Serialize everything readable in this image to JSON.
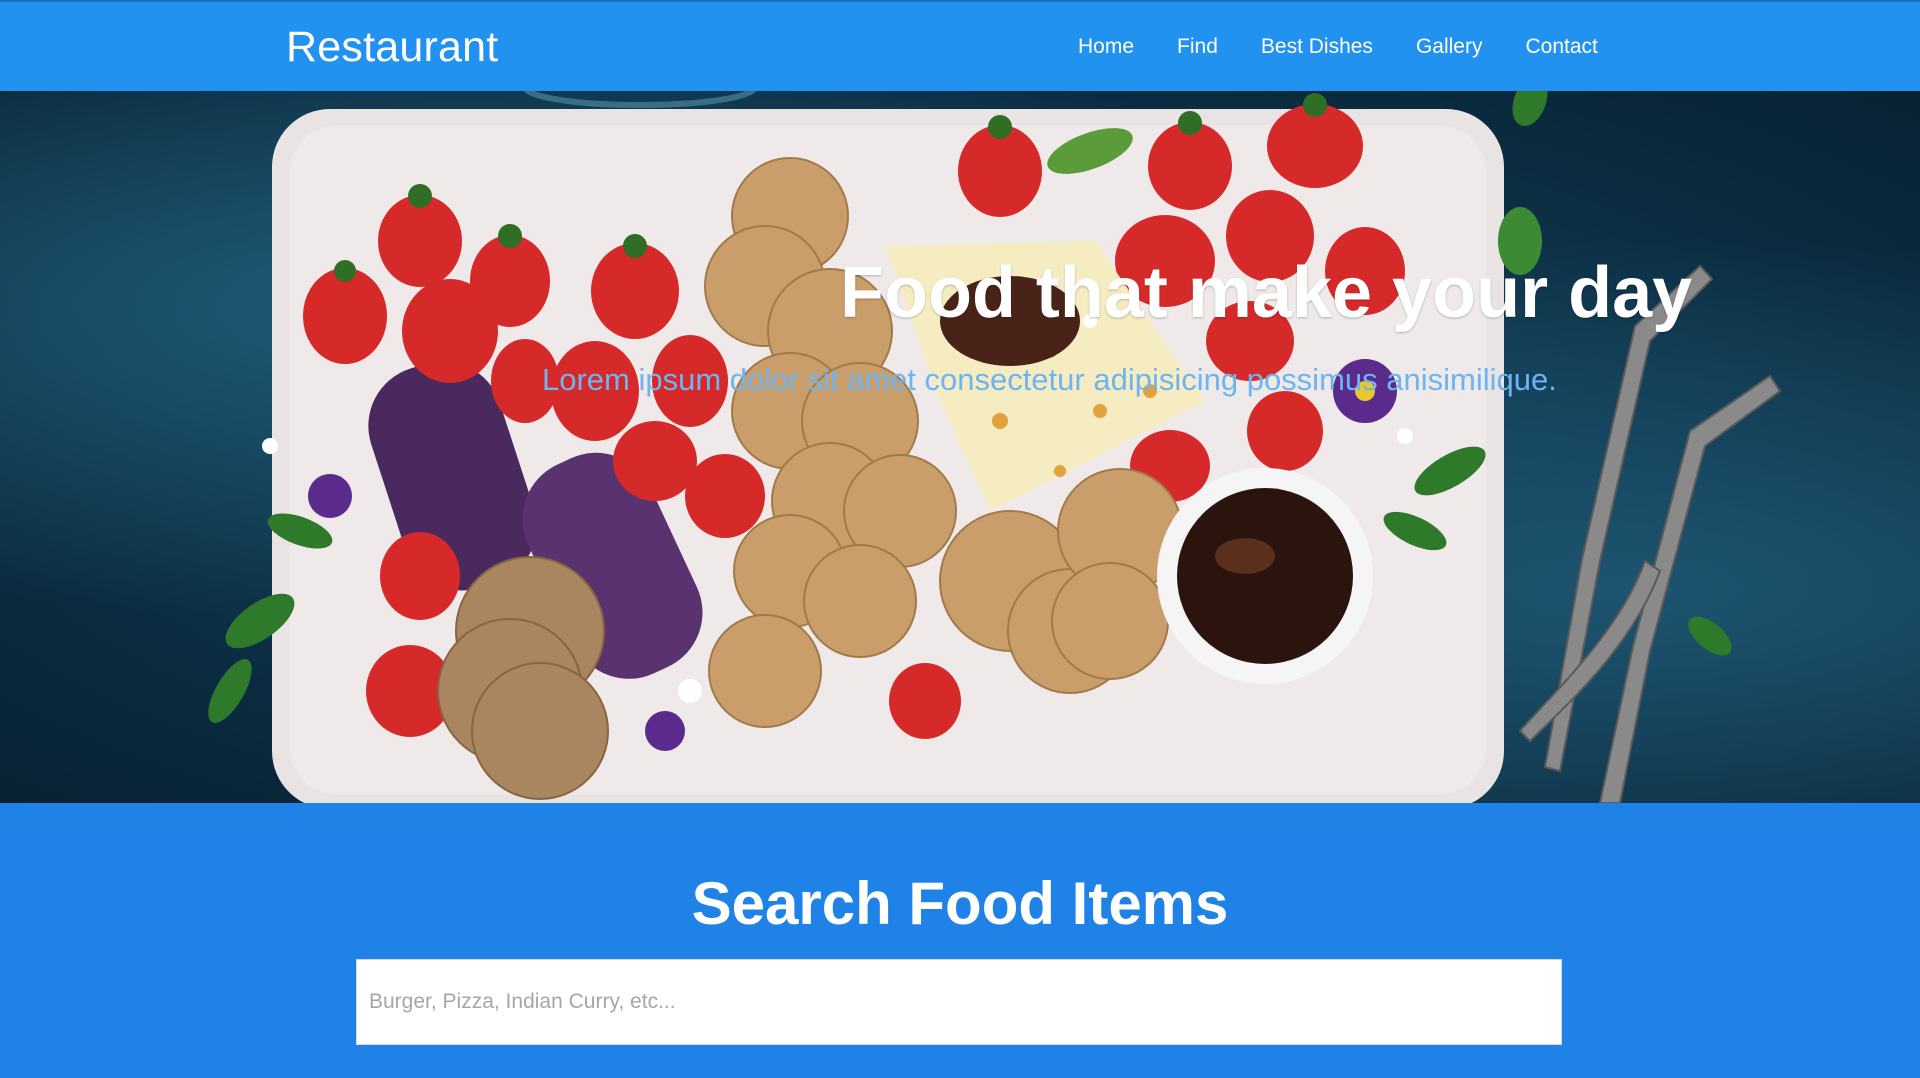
{
  "navbar": {
    "brand": "Restaurant",
    "links": [
      "Home",
      "Find",
      "Best Dishes",
      "Gallery",
      "Contact"
    ],
    "background": "#2192f0"
  },
  "hero": {
    "title": "Food that make your day",
    "subtitle": "Lorem ipsum dolor sit amet consectetur adipisicing possimus anisimilique.",
    "image": "food-platter-photo"
  },
  "search": {
    "title": "Search Food Items",
    "placeholder": "Burger, Pizza, Indian Curry, etc...",
    "value": "",
    "background": "#1e82e6"
  }
}
